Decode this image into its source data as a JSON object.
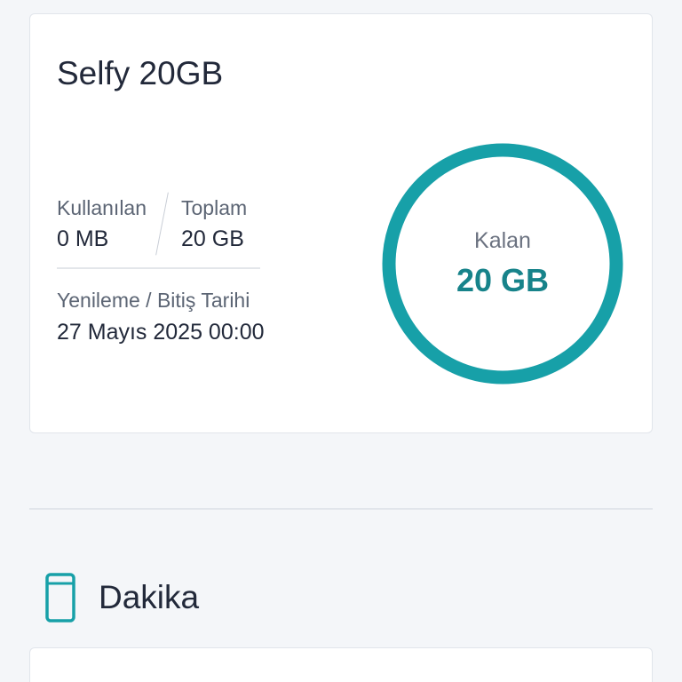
{
  "plan": {
    "title": "Selfy 20GB",
    "used_label": "Kullanılan",
    "used_value": "0 MB",
    "total_label": "Toplam",
    "total_value": "20 GB",
    "renewal_label": "Yenileme / Bitiş Tarihi",
    "renewal_value": "27 Mayıs 2025 00:00",
    "remaining_label": "Kalan",
    "remaining_value": "20 GB",
    "remaining_fraction": 1.0
  },
  "minutes_section": {
    "title": "Dakika",
    "icon": "phone-icon"
  },
  "colors": {
    "accent": "#17a0a8",
    "accent_text": "#17838a",
    "page_background": "#f4f6f9",
    "card_background": "#ffffff"
  }
}
